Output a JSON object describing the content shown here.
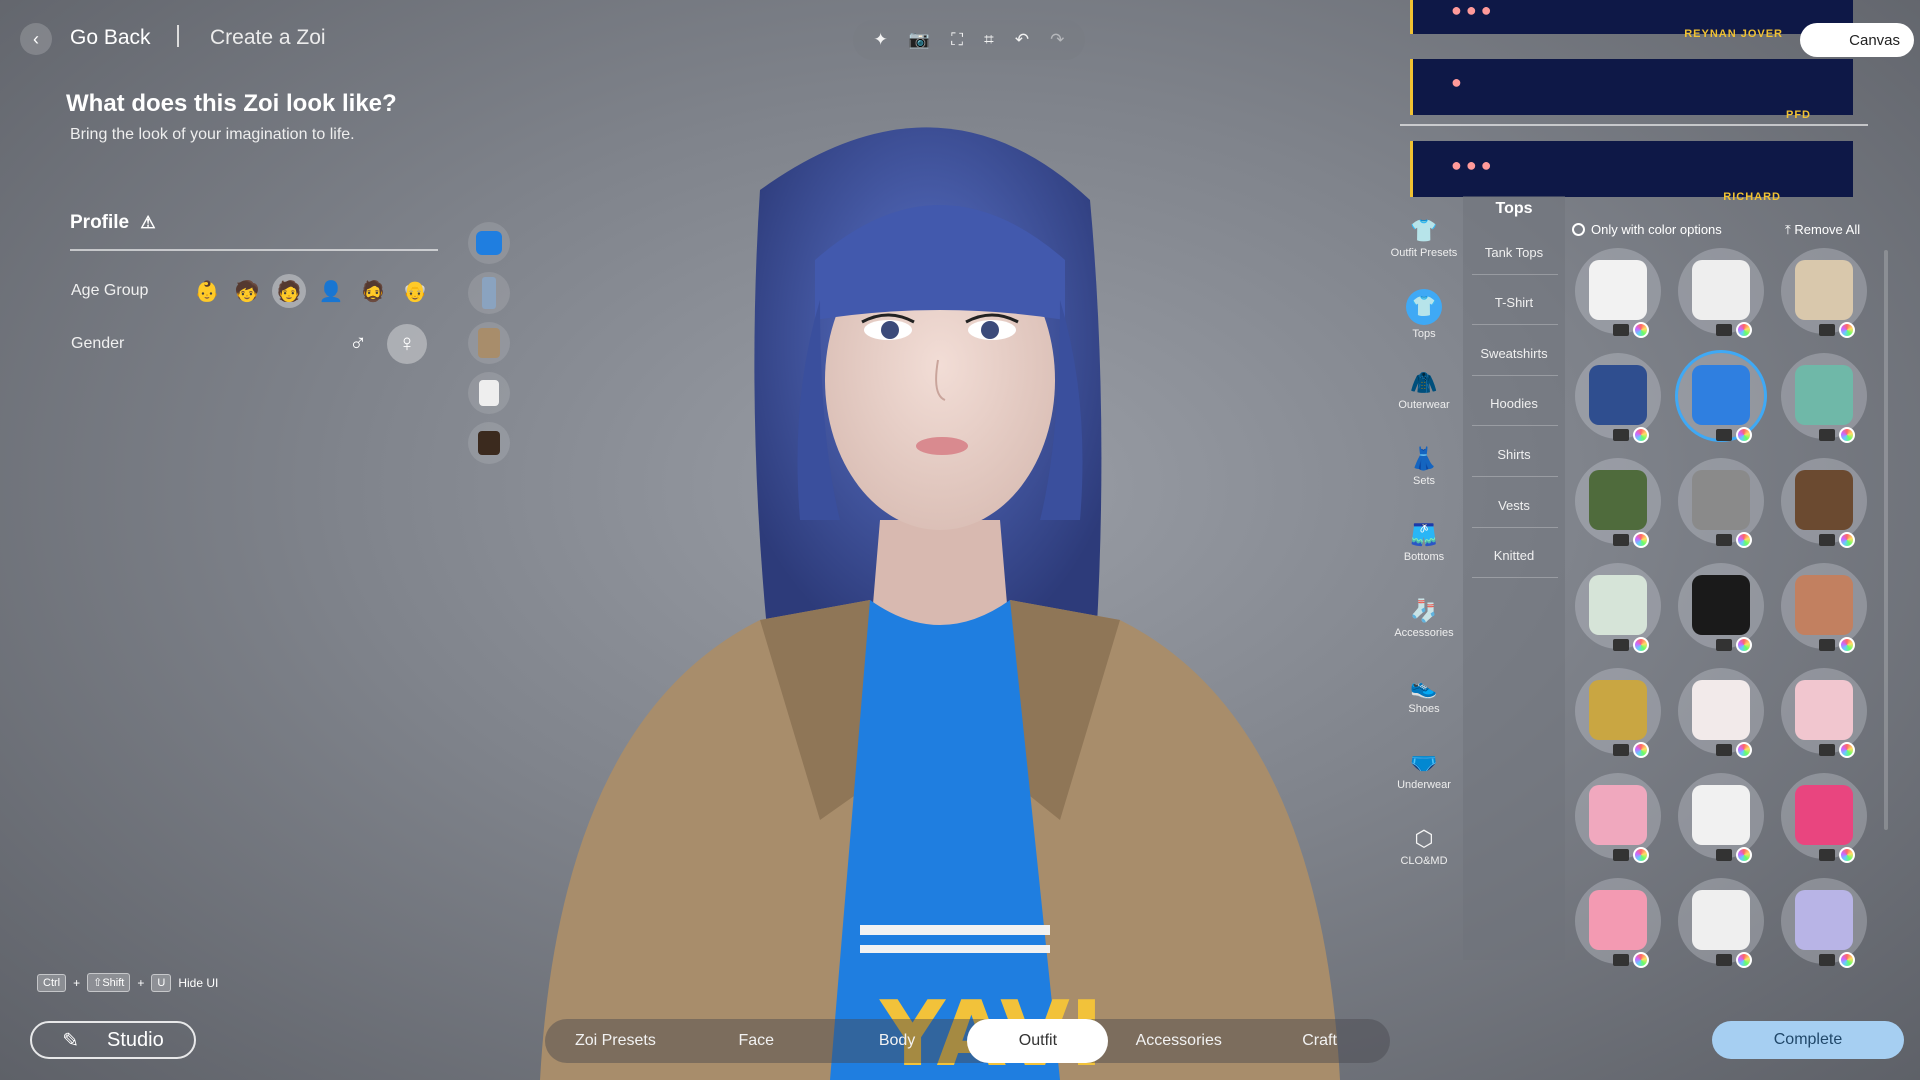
{
  "header": {
    "back_label": "Go Back",
    "page_title": "Create a Zoi"
  },
  "toolbar": {
    "icons": [
      "sparkle-icon",
      "camera-icon",
      "focus-icon",
      "capture-icon",
      "undo-icon",
      "redo-icon"
    ]
  },
  "question": {
    "title": "What does this Zoi look like?",
    "subtitle": "Bring the look of your imagination to life."
  },
  "profile": {
    "title": "Profile",
    "age_group_label": "Age Group",
    "gender_label": "Gender"
  },
  "shortcut": {
    "keys": [
      "Ctrl",
      "⇧Shift",
      "U"
    ],
    "label": "Hide UI"
  },
  "studio_label": "Studio",
  "tabs": [
    "Zoi Presets",
    "Face",
    "Body",
    "Outfit",
    "Accessories",
    "Craft"
  ],
  "complete_label": "Complete",
  "banners": [
    {
      "name": "REYNAN JOVER"
    },
    {
      "name": "PFD"
    },
    {
      "name": "RICHARD"
    }
  ],
  "canvas_label": "Canvas",
  "categories": [
    {
      "label": "Outfit Presets",
      "icon": "outfit-presets-icon"
    },
    {
      "label": "Tops",
      "icon": "tops-icon"
    },
    {
      "label": "Outerwear",
      "icon": "outerwear-icon"
    },
    {
      "label": "Sets",
      "icon": "sets-icon"
    },
    {
      "label": "Bottoms",
      "icon": "bottoms-icon"
    },
    {
      "label": "Accessories",
      "icon": "accessories-icon"
    },
    {
      "label": "Shoes",
      "icon": "shoes-icon"
    },
    {
      "label": "Underwear",
      "icon": "underwear-icon"
    },
    {
      "label": "CLO&MD",
      "icon": "clomd-icon"
    }
  ],
  "subpanel": {
    "title": "Tops",
    "items": [
      "Tank Tops",
      "T-Shirt",
      "Sweatshirts",
      "Hoodies",
      "Shirts",
      "Vests",
      "Knitted"
    ]
  },
  "filters": {
    "color_options_label": "Only with color options",
    "remove_all_label": "Remove All"
  },
  "items_grid": {
    "selected_index": 4,
    "tints": [
      "#f2f2f2",
      "#eeeeee",
      "#d9c8ac",
      "#2f4e8f",
      "#2f7fe0",
      "#6fb8a8",
      "#4f6b3c",
      "#8a8a8a",
      "#6b4a30",
      "#d6e4d8",
      "#1a1a1a",
      "#c28060",
      "#c9a642",
      "#f2eaea",
      "#f1c6cf",
      "#f0a8be",
      "#f1f1f1",
      "#e9457f",
      "#f39ab2",
      "#efefef",
      "#b8b4e6"
    ]
  }
}
